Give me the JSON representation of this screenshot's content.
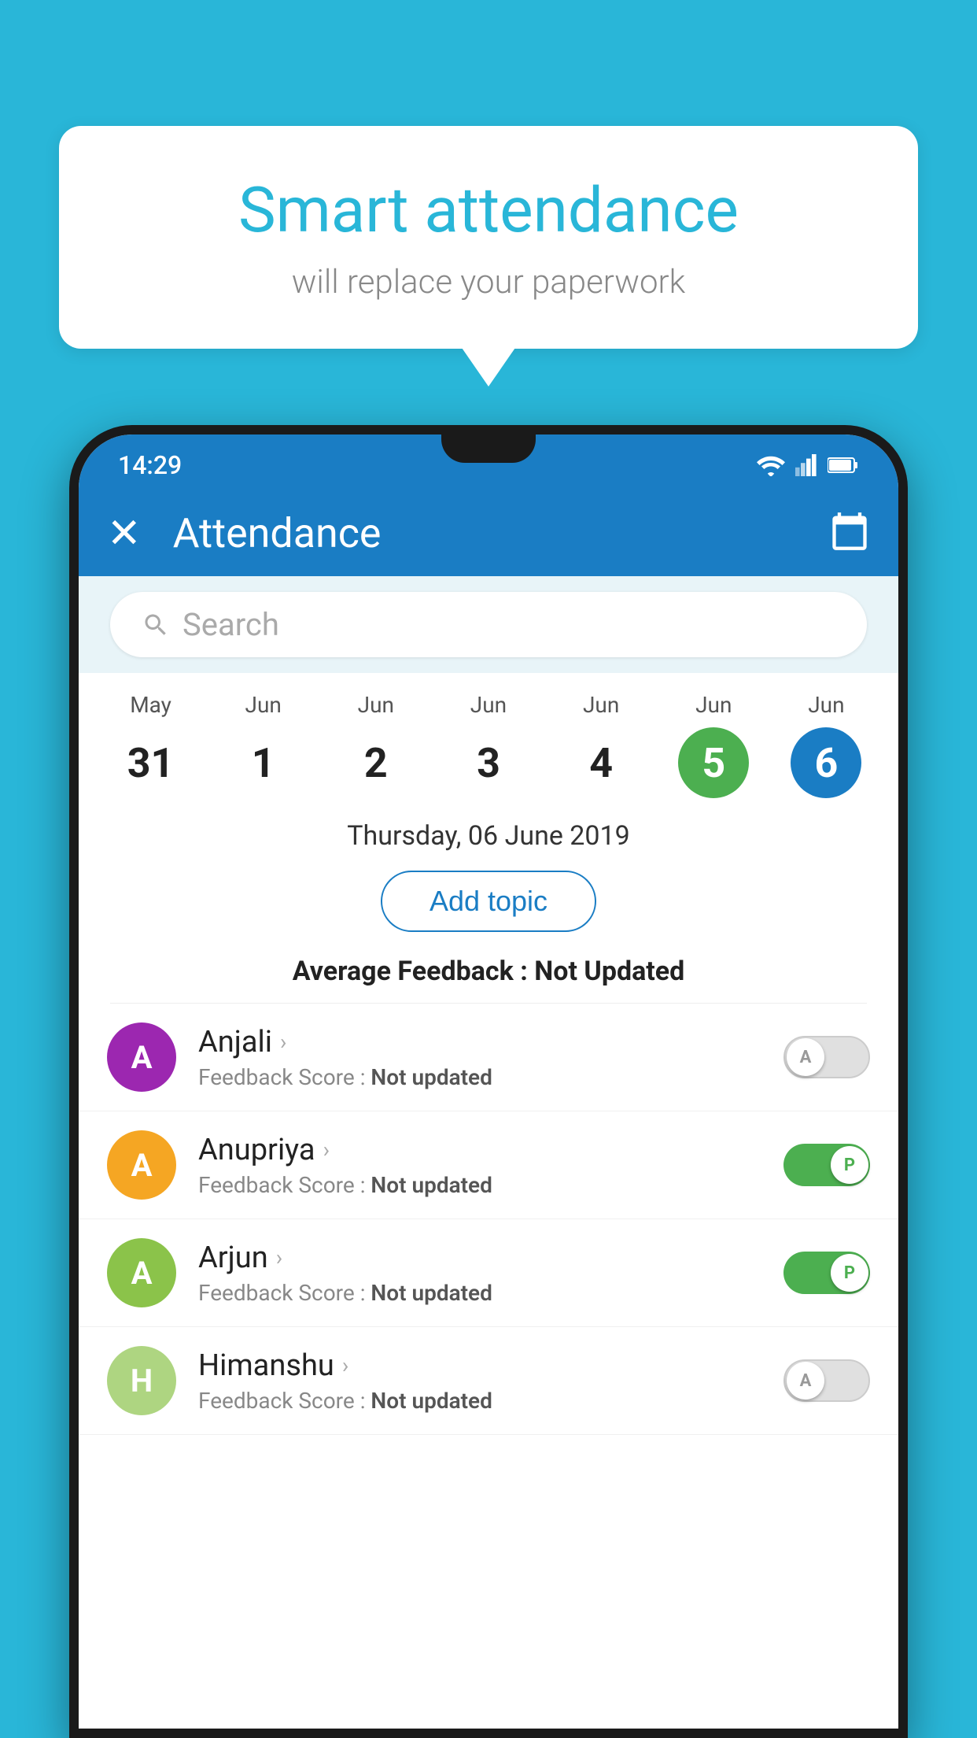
{
  "background_color": "#29b6d8",
  "speech_bubble": {
    "heading": "Smart attendance",
    "subtext": "will replace your paperwork"
  },
  "status_bar": {
    "time": "14:29"
  },
  "app_bar": {
    "title": "Attendance",
    "close_label": "✕",
    "calendar_icon": "calendar-icon"
  },
  "search": {
    "placeholder": "Search"
  },
  "calendar": {
    "days": [
      {
        "month": "May",
        "number": "31",
        "state": "normal"
      },
      {
        "month": "Jun",
        "number": "1",
        "state": "normal"
      },
      {
        "month": "Jun",
        "number": "2",
        "state": "normal"
      },
      {
        "month": "Jun",
        "number": "3",
        "state": "normal"
      },
      {
        "month": "Jun",
        "number": "4",
        "state": "normal"
      },
      {
        "month": "Jun",
        "number": "5",
        "state": "today"
      },
      {
        "month": "Jun",
        "number": "6",
        "state": "selected"
      }
    ],
    "selected_date": "Thursday, 06 June 2019"
  },
  "add_topic_label": "Add topic",
  "avg_feedback_label": "Average Feedback : ",
  "avg_feedback_value": "Not Updated",
  "students": [
    {
      "name": "Anjali",
      "avatar_letter": "A",
      "avatar_color": "#9c27b0",
      "feedback_label": "Feedback Score : ",
      "feedback_value": "Not updated",
      "attendance": "absent",
      "toggle_label": "A"
    },
    {
      "name": "Anupriya",
      "avatar_letter": "A",
      "avatar_color": "#f5a623",
      "feedback_label": "Feedback Score : ",
      "feedback_value": "Not updated",
      "attendance": "present",
      "toggle_label": "P"
    },
    {
      "name": "Arjun",
      "avatar_letter": "A",
      "avatar_color": "#8bc34a",
      "feedback_label": "Feedback Score : ",
      "feedback_value": "Not updated",
      "attendance": "present",
      "toggle_label": "P"
    },
    {
      "name": "Himanshu",
      "avatar_letter": "H",
      "avatar_color": "#aed581",
      "feedback_label": "Feedback Score : ",
      "feedback_value": "Not updated",
      "attendance": "absent",
      "toggle_label": "A"
    }
  ]
}
